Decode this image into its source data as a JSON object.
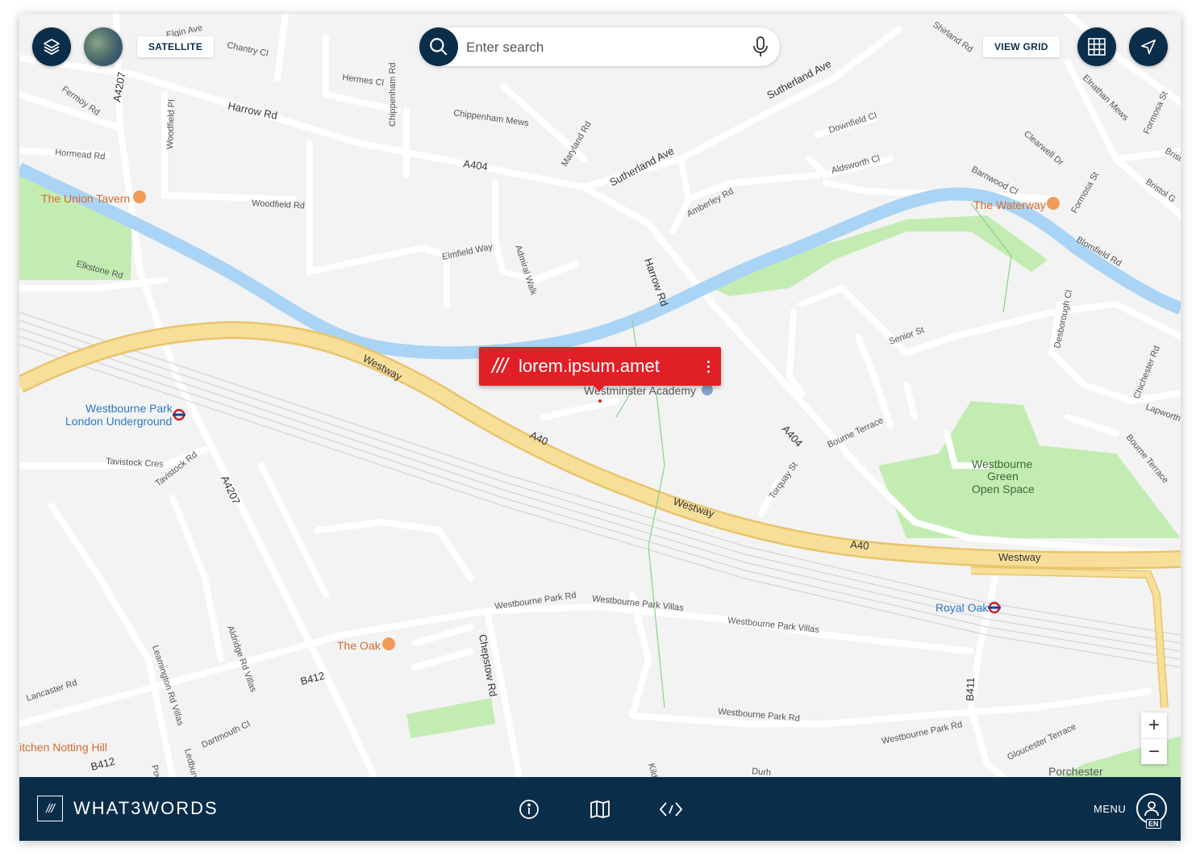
{
  "toolbar": {
    "satellite_label": "SATELLITE",
    "view_grid_label": "VIEW GRID",
    "layers_icon": "layers-icon",
    "grid_icon": "grid-icon",
    "locate_icon": "navigation-arrow-icon"
  },
  "search": {
    "placeholder": "Enter search",
    "search_icon": "search-icon",
    "mic_icon": "microphone-icon"
  },
  "callout": {
    "slashes": "///",
    "words": "lorem.ipsum.amet",
    "color": "#e11f26"
  },
  "map": {
    "street_labels": [
      "Elgin Ave",
      "Chantry Cl",
      "Hermes Cl",
      "Chippenham Rd",
      "Harrow Rd",
      "Fermoy Rd",
      "Chippenham Mews",
      "Woodfield Pl",
      "Hormead Rd",
      "A404",
      "Maryland Rd",
      "Sutherland Ave",
      "Shirland Rd",
      "Elnathan Mews",
      "Formosa St",
      "Downfield Cl",
      "Clearwell Dr",
      "Aldsworth Cl",
      "Barnwood Cl",
      "Bristol G",
      "Woodfield Rd",
      "Amberley Rd",
      "Elmfield Way",
      "Admiral Walk",
      "Blomfield Rd",
      "Elkstone Rd",
      "Westway",
      "A40",
      "Senior St",
      "Desborough Cl",
      "Chichester Rd",
      "Lapworth C",
      "Bourne Terrace",
      "Tavistock Cres",
      "Tavistock Rd",
      "A4207",
      "Torquay St",
      "Westbourne Park Rd",
      "Westbourne Park Villas",
      "Chepstow Rd",
      "Aldridge Rd Villas",
      "Leamington Rd Villas",
      "Lancaster Rd",
      "B412",
      "Dartmouth Cl",
      "Ledbury",
      "B411",
      "Gloucester Terrace",
      "Brist",
      "Kild",
      "Durh",
      "Powi"
    ],
    "poi": {
      "union_tavern": "The Union Tavern",
      "waterway": "The Waterway",
      "the_oak": "The Oak",
      "school": "Westminster Academy",
      "kitchen": "itchen Notting Hill",
      "porchester": "Porchester"
    },
    "stations": {
      "westbourne_park_1": "Westbourne Park",
      "westbourne_park_2": "London Underground",
      "royal_oak": "Royal Oak"
    },
    "park": {
      "line1": "Westbourne",
      "line2": "Green",
      "line3": "Open Space"
    },
    "colors": {
      "background": "#f3f3f3",
      "road": "#ffffff",
      "motorway": "#f7d98a",
      "motorway_edge": "#e9c46a",
      "water": "#a9d4f5",
      "park": "#c3ecb2",
      "rail": "#c9c9c9"
    }
  },
  "zoom": {
    "in": "+",
    "out": "−"
  },
  "footer": {
    "logo_mark": "///",
    "brand": "WHAT3WORDS",
    "menu_label": "MENU",
    "language_badge": "EN",
    "info_icon": "info-icon",
    "map_icon": "map-icon",
    "api_icon": "code-icon",
    "user_icon": "user-icon",
    "background": "#0a2d4a"
  }
}
